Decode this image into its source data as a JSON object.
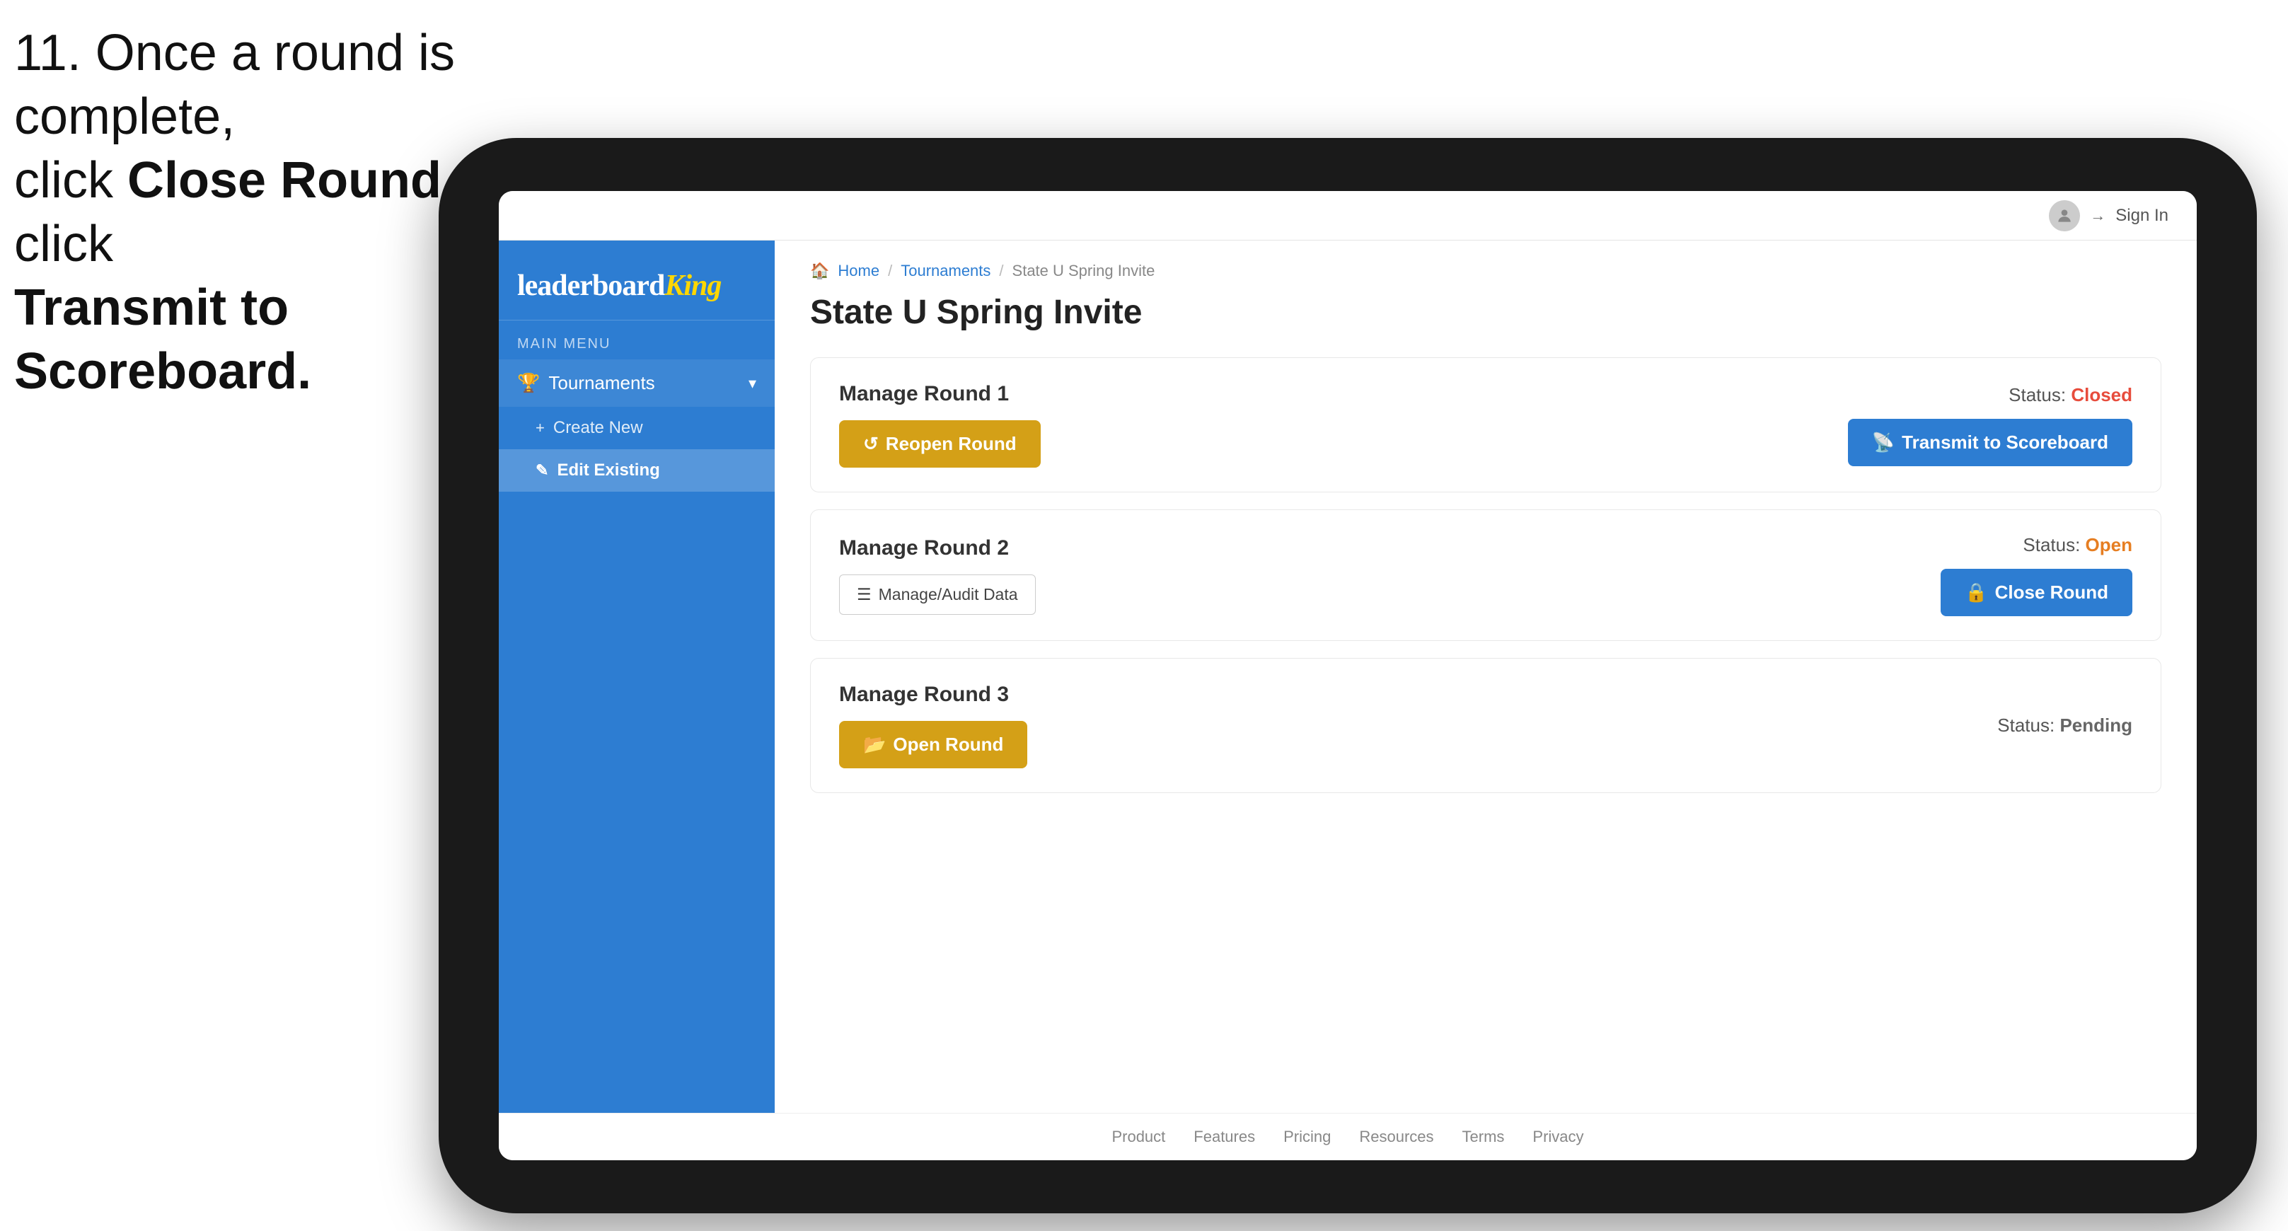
{
  "instruction": {
    "line1": "11. Once a round is complete,",
    "line2": "click ",
    "bold1": "Close Round",
    "line3": " then click",
    "bold2": "Transmit to Scoreboard."
  },
  "header": {
    "sign_in_label": "Sign In"
  },
  "logo": {
    "leaderboard": "leaderboard",
    "king": "King"
  },
  "sidebar": {
    "main_menu_label": "MAIN MENU",
    "tournaments_label": "Tournaments",
    "create_new_label": "Create New",
    "edit_existing_label": "Edit Existing"
  },
  "breadcrumb": {
    "home": "Home",
    "sep1": "/",
    "tournaments": "Tournaments",
    "sep2": "/",
    "current": "State U Spring Invite"
  },
  "page": {
    "title": "State U Spring Invite"
  },
  "rounds": [
    {
      "id": 1,
      "title": "Manage Round 1",
      "status_label": "Status:",
      "status_value": "Closed",
      "status_type": "closed",
      "primary_btn_label": "Reopen Round",
      "primary_btn_type": "orange",
      "secondary_btn_label": "Transmit to Scoreboard",
      "secondary_btn_type": "blue"
    },
    {
      "id": 2,
      "title": "Manage Round 2",
      "status_label": "Status:",
      "status_value": "Open",
      "status_type": "open",
      "primary_btn_label": "Manage/Audit Data",
      "primary_btn_type": "outline",
      "secondary_btn_label": "Close Round",
      "secondary_btn_type": "blue"
    },
    {
      "id": 3,
      "title": "Manage Round 3",
      "status_label": "Status:",
      "status_value": "Pending",
      "status_type": "pending",
      "primary_btn_label": "Open Round",
      "primary_btn_type": "orange",
      "secondary_btn_label": null,
      "secondary_btn_type": null
    }
  ],
  "footer": {
    "links": [
      "Product",
      "Features",
      "Pricing",
      "Resources",
      "Terms",
      "Privacy"
    ]
  }
}
